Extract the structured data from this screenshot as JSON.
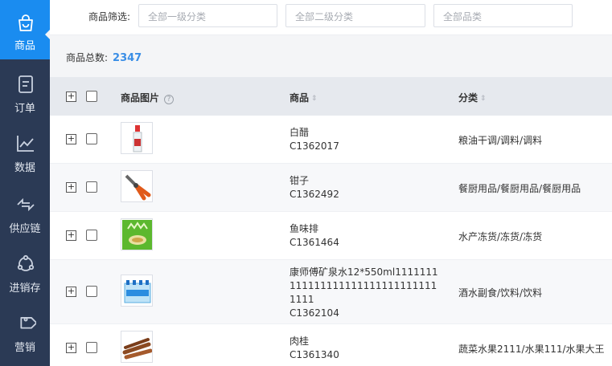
{
  "sidebar": {
    "items": [
      {
        "label": "商品",
        "icon": "shopping-bag-icon",
        "active": true
      },
      {
        "label": "订单",
        "icon": "order-document-icon",
        "active": false
      },
      {
        "label": "数据",
        "icon": "line-chart-icon",
        "active": false
      },
      {
        "label": "供应链",
        "icon": "supply-chain-arrows-icon",
        "active": false
      },
      {
        "label": "进销存",
        "icon": "inventory-cycle-icon",
        "active": false
      },
      {
        "label": "营销",
        "icon": "price-tag-icon",
        "active": false
      }
    ],
    "colors": {
      "background": "#2b3a55",
      "active": "#1a8cf0"
    }
  },
  "filter": {
    "label": "商品筛选:",
    "select1_placeholder": "全部一级分类",
    "select2_placeholder": "全部二级分类",
    "select3_placeholder": "全部品类"
  },
  "summary": {
    "label": "商品总数:",
    "count": "2347"
  },
  "table": {
    "headers": {
      "image": "商品图片",
      "product": "商品",
      "category": "分类"
    },
    "rows": [
      {
        "name": "白醋",
        "code": "C1362017",
        "category": "粮油干调/调料/调料",
        "image_icon": "vinegar-bottle-image"
      },
      {
        "name": "钳子",
        "code": "C1362492",
        "category": "餐厨用品/餐厨用品/餐厨用品",
        "image_icon": "pliers-image"
      },
      {
        "name": "鱼味排",
        "code": "C1361464",
        "category": "水产冻货/冻货/冻货",
        "image_icon": "fish-snack-pack-image"
      },
      {
        "name": "康师傅矿泉水12*550ml11111111111111111111111111111111111",
        "code": "C1362104",
        "category": "酒水副食/饮料/饮料",
        "image_icon": "water-bottles-pack-image"
      },
      {
        "name": "肉桂",
        "code": "C1361340",
        "category": "蔬菜水果2111/水果111/水果大王",
        "image_icon": "cinnamon-sticks-image"
      }
    ]
  },
  "colors": {
    "accent": "#3a8ee6",
    "header_bg": "#e6e9ee"
  }
}
